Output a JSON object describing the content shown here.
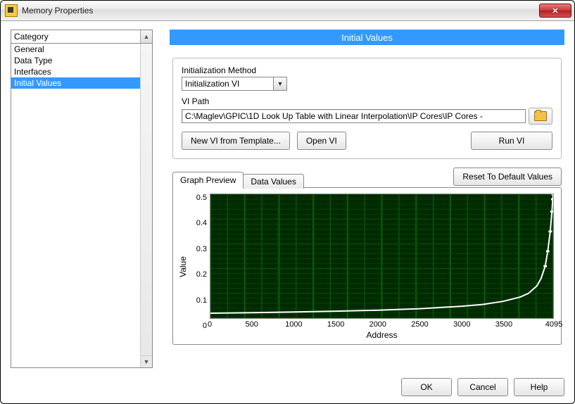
{
  "window": {
    "title": "Memory Properties"
  },
  "sidebar": {
    "header": "Category",
    "items": [
      {
        "label": "General",
        "selected": false
      },
      {
        "label": "Data Type",
        "selected": false
      },
      {
        "label": "Interfaces",
        "selected": false
      },
      {
        "label": "Initial Values",
        "selected": true
      }
    ]
  },
  "panel": {
    "title": "Initial Values",
    "init_method_label": "Initialization Method",
    "init_method_value": "Initialization VI",
    "vi_path_label": "VI Path",
    "vi_path_value": "C:\\Maglev\\GPIC\\1D Look Up Table with Linear Interpolation\\IP Cores\\IP Cores -",
    "new_vi_btn": "New VI from Template...",
    "open_vi_btn": "Open VI",
    "run_vi_btn": "Run VI"
  },
  "tabs": {
    "graph_preview": "Graph Preview",
    "data_values": "Data Values",
    "reset_btn": "Reset To Default Values"
  },
  "buttons": {
    "ok": "OK",
    "cancel": "Cancel",
    "help": "Help"
  },
  "chart_data": {
    "type": "line",
    "title": "",
    "xlabel": "Address",
    "ylabel": "Value",
    "xlim": [
      0,
      4095
    ],
    "ylim": [
      0,
      0.5
    ],
    "xticks": [
      0,
      500,
      1000,
      1500,
      2000,
      2500,
      3000,
      3500,
      4095
    ],
    "yticks": [
      0,
      0.1,
      0.2,
      0.3,
      0.4,
      0.5
    ],
    "grid": true,
    "background": "#002a00",
    "grid_color": "#0a5a0a",
    "series": [
      {
        "name": "value",
        "color": "#ffffff",
        "x": [
          0,
          500,
          1000,
          1500,
          2000,
          2500,
          3000,
          3250,
          3500,
          3700,
          3800,
          3900,
          3950,
          4000,
          4030,
          4060,
          4080,
          4090,
          4095
        ],
        "values": [
          0.02,
          0.022,
          0.025,
          0.028,
          0.032,
          0.038,
          0.048,
          0.055,
          0.068,
          0.085,
          0.1,
          0.13,
          0.16,
          0.21,
          0.27,
          0.35,
          0.43,
          0.48,
          0.5
        ]
      }
    ]
  }
}
